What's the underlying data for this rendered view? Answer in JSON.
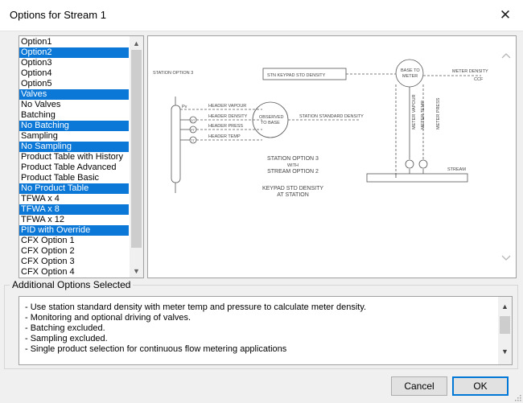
{
  "window": {
    "title": "Options for Stream 1",
    "close_glyph": "✕"
  },
  "options_list": {
    "items": [
      {
        "label": "Option1",
        "selected": false
      },
      {
        "label": "Option2",
        "selected": true
      },
      {
        "label": "Option3",
        "selected": false
      },
      {
        "label": "Option4",
        "selected": false
      },
      {
        "label": "Option5",
        "selected": false
      },
      {
        "label": "Valves",
        "selected": true
      },
      {
        "label": "No Valves",
        "selected": false
      },
      {
        "label": "Batching",
        "selected": false
      },
      {
        "label": "No Batching",
        "selected": true
      },
      {
        "label": "Sampling",
        "selected": false
      },
      {
        "label": "No Sampling",
        "selected": true
      },
      {
        "label": "Product Table with History",
        "selected": false
      },
      {
        "label": "Product Table Advanced",
        "selected": false
      },
      {
        "label": "Product Table Basic",
        "selected": false
      },
      {
        "label": "No Product Table",
        "selected": true
      },
      {
        "label": "TFWA x 4",
        "selected": false
      },
      {
        "label": "TFWA x 8",
        "selected": true
      },
      {
        "label": "TFWA x 12",
        "selected": false
      },
      {
        "label": "PID with Override",
        "selected": true
      },
      {
        "label": "CFX Option 1",
        "selected": false
      },
      {
        "label": "CFX Option 2",
        "selected": false
      },
      {
        "label": "CFX Option 3",
        "selected": false
      },
      {
        "label": "CFX Option 4",
        "selected": false
      }
    ]
  },
  "diagram": {
    "station_option_label": "STATION OPTION 3",
    "keypad_box": "STN KEYPAD STD DENSITY",
    "base_to_meter_1": "BASE TO",
    "base_to_meter_2": "METER",
    "meter_density": "METER DENSITY",
    "ccf": "CCF",
    "pv": "Pv",
    "header_vapour": "HEADER VAPOUR",
    "header_density": "HEADER DENSITY",
    "header_press": "HEADER PRESS",
    "header_temp": "HEADER TEMP",
    "dt": "DT",
    "pt": "PT",
    "tt": "TT",
    "observed_1": "OBSERVED",
    "observed_2": "TO BASE",
    "station_standard_density": "STATION STANDARD DENSITY",
    "meter_vapour": "METER VAPOUR",
    "meter_temp": "METER TEMP",
    "meter_press": "METER PRESS",
    "stream": "STREAM",
    "caption_1": "STATION OPTION 3",
    "caption_2": "WITH",
    "caption_3": "STREAM OPTION 2",
    "caption_4": "KEYPAD STD DENSITY",
    "caption_5": "AT STATION"
  },
  "additional": {
    "legend": "Additional Options Selected",
    "lines": [
      "- Use station standard density with meter temp and pressure to calculate meter density.",
      "- Monitoring and optional driving of valves.",
      "- Batching excluded.",
      "- Sampling excluded.",
      "- Single product selection for continuous flow metering applications"
    ]
  },
  "buttons": {
    "cancel": "Cancel",
    "ok": "OK"
  },
  "colors": {
    "selection": "#0b78d7",
    "window_bg": "#f0f0f0"
  }
}
